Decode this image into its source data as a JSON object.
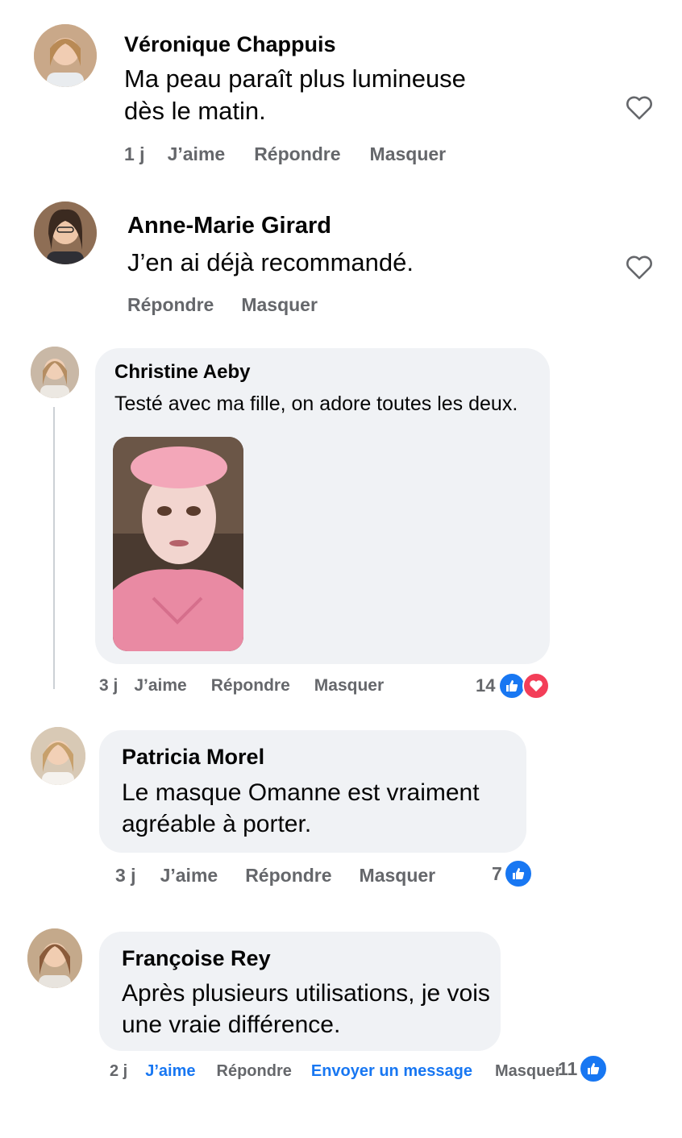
{
  "comments": [
    {
      "author": "Véronique Chappuis",
      "text_lines": [
        "Ma peau paraît plus lumineuse",
        "dès le matin."
      ],
      "time": "1 j",
      "like": "J’aime",
      "reply": "Répondre",
      "hide": "Masquer",
      "avatar_icon": "person-photo",
      "liked_icon": "heart-outline-icon"
    },
    {
      "author": "Anne-Marie Girard",
      "text_lines": [
        "J’en ai déjà recommandé."
      ],
      "reply": "Répondre",
      "hide": "Masquer",
      "avatar_icon": "person-photo",
      "liked_icon": "heart-outline-icon"
    },
    {
      "author": "Christine Aeby",
      "text_lines": [
        "Testé avec ma fille, on adore toutes les deux."
      ],
      "time": "3 j",
      "like": "J’aime",
      "reply": "Répondre",
      "hide": "Masquer",
      "reaction_count": "14",
      "reactions": [
        "like",
        "love"
      ],
      "attachment": "photo-face-mask"
    },
    {
      "author": "Patricia Morel",
      "text_lines": [
        "Le masque Omanne est vraiment",
        "agréable à porter."
      ],
      "time": "3 j",
      "like": "J’aime",
      "reply": "Répondre",
      "hide": "Masquer",
      "reaction_count": "7",
      "reactions": [
        "like"
      ]
    },
    {
      "author": "Françoise Rey",
      "text_lines": [
        "Après plusieurs utilisations, je vois",
        "une vraie différence."
      ],
      "time": "2 j",
      "like": "J’aime",
      "reply": "Répondre",
      "message": "Envoyer un message",
      "hide": "Masquer",
      "reaction_count": "11",
      "reactions": [
        "like"
      ]
    }
  ],
  "colors": {
    "bubble": "#f0f2f5",
    "meta_text": "#65676b",
    "link_blue": "#1877f2",
    "love_red": "#f33e58"
  }
}
